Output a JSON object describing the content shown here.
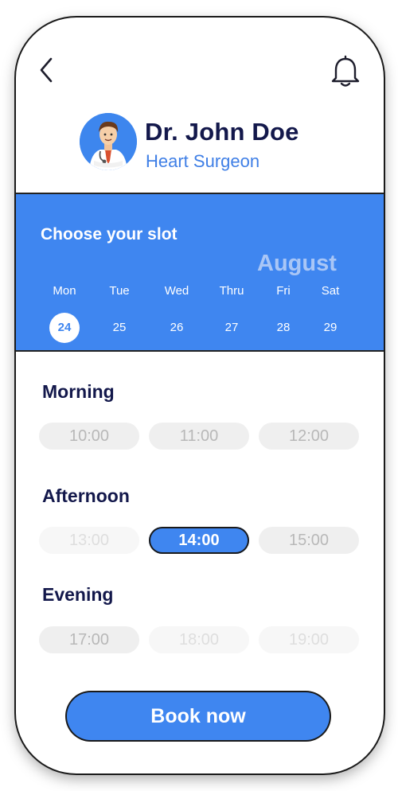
{
  "header": {
    "back_icon": "chevron-left-icon",
    "bell_icon": "bell-icon"
  },
  "doctor": {
    "name": "Dr. John Doe",
    "specialty": "Heart Surgeon",
    "avatar_icon": "doctor-avatar"
  },
  "schedule": {
    "heading": "Choose your slot",
    "month": "August",
    "days": [
      {
        "name": "Mon",
        "date": "24",
        "selected": true
      },
      {
        "name": "Tue",
        "date": "25",
        "selected": false
      },
      {
        "name": "Wed",
        "date": "26",
        "selected": false
      },
      {
        "name": "Thru",
        "date": "27",
        "selected": false
      },
      {
        "name": "Fri",
        "date": "28",
        "selected": false
      },
      {
        "name": "Sat",
        "date": "29",
        "selected": false
      }
    ]
  },
  "morning": {
    "label": "Morning",
    "slots": [
      {
        "time": "10:00",
        "state": "available"
      },
      {
        "time": "11:00",
        "state": "available"
      },
      {
        "time": "12:00",
        "state": "available"
      }
    ]
  },
  "afternoon": {
    "label": "Afternoon",
    "slots": [
      {
        "time": "13:00",
        "state": "disabled"
      },
      {
        "time": "14:00",
        "state": "selected"
      },
      {
        "time": "15:00",
        "state": "available"
      }
    ]
  },
  "evening": {
    "label": "Evening",
    "slots": [
      {
        "time": "17:00",
        "state": "available"
      },
      {
        "time": "18:00",
        "state": "disabled"
      },
      {
        "time": "19:00",
        "state": "disabled"
      }
    ]
  },
  "actions": {
    "book_label": "Book now"
  },
  "colors": {
    "primary": "#3f86f0",
    "navy": "#13184b",
    "slot_bg": "#efefef",
    "slot_text": "#b8b8b8"
  }
}
